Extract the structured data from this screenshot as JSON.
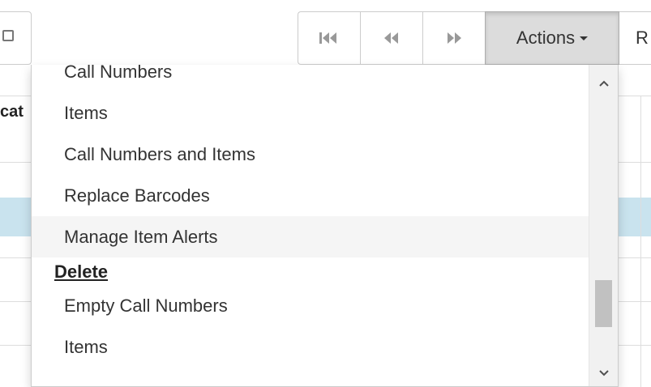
{
  "toolbar": {
    "left_control_icon": "checkbox-icon",
    "nav_buttons": [
      {
        "name": "first-page-icon"
      },
      {
        "name": "previous-page-icon"
      },
      {
        "name": "next-page-icon"
      }
    ],
    "actions_label": "Actions",
    "next_button_label": "R"
  },
  "grid": {
    "header_partial": "cat",
    "highlight_color": "#c9e3ee"
  },
  "menu": {
    "items": [
      {
        "label": "Call Numbers",
        "type": "item"
      },
      {
        "label": "Items",
        "type": "item"
      },
      {
        "label": "Call Numbers and Items",
        "type": "item"
      },
      {
        "label": "Replace Barcodes",
        "type": "item"
      },
      {
        "label": "Manage Item Alerts",
        "type": "item",
        "hover": true
      },
      {
        "label": "Delete",
        "type": "header"
      },
      {
        "label": "Empty Call Numbers",
        "type": "item"
      },
      {
        "label": "Items",
        "type": "item"
      }
    ],
    "scroll_up_icon": "chevron-up-icon",
    "scroll_down_icon": "chevron-down-icon",
    "scroll_position": 0.72
  }
}
